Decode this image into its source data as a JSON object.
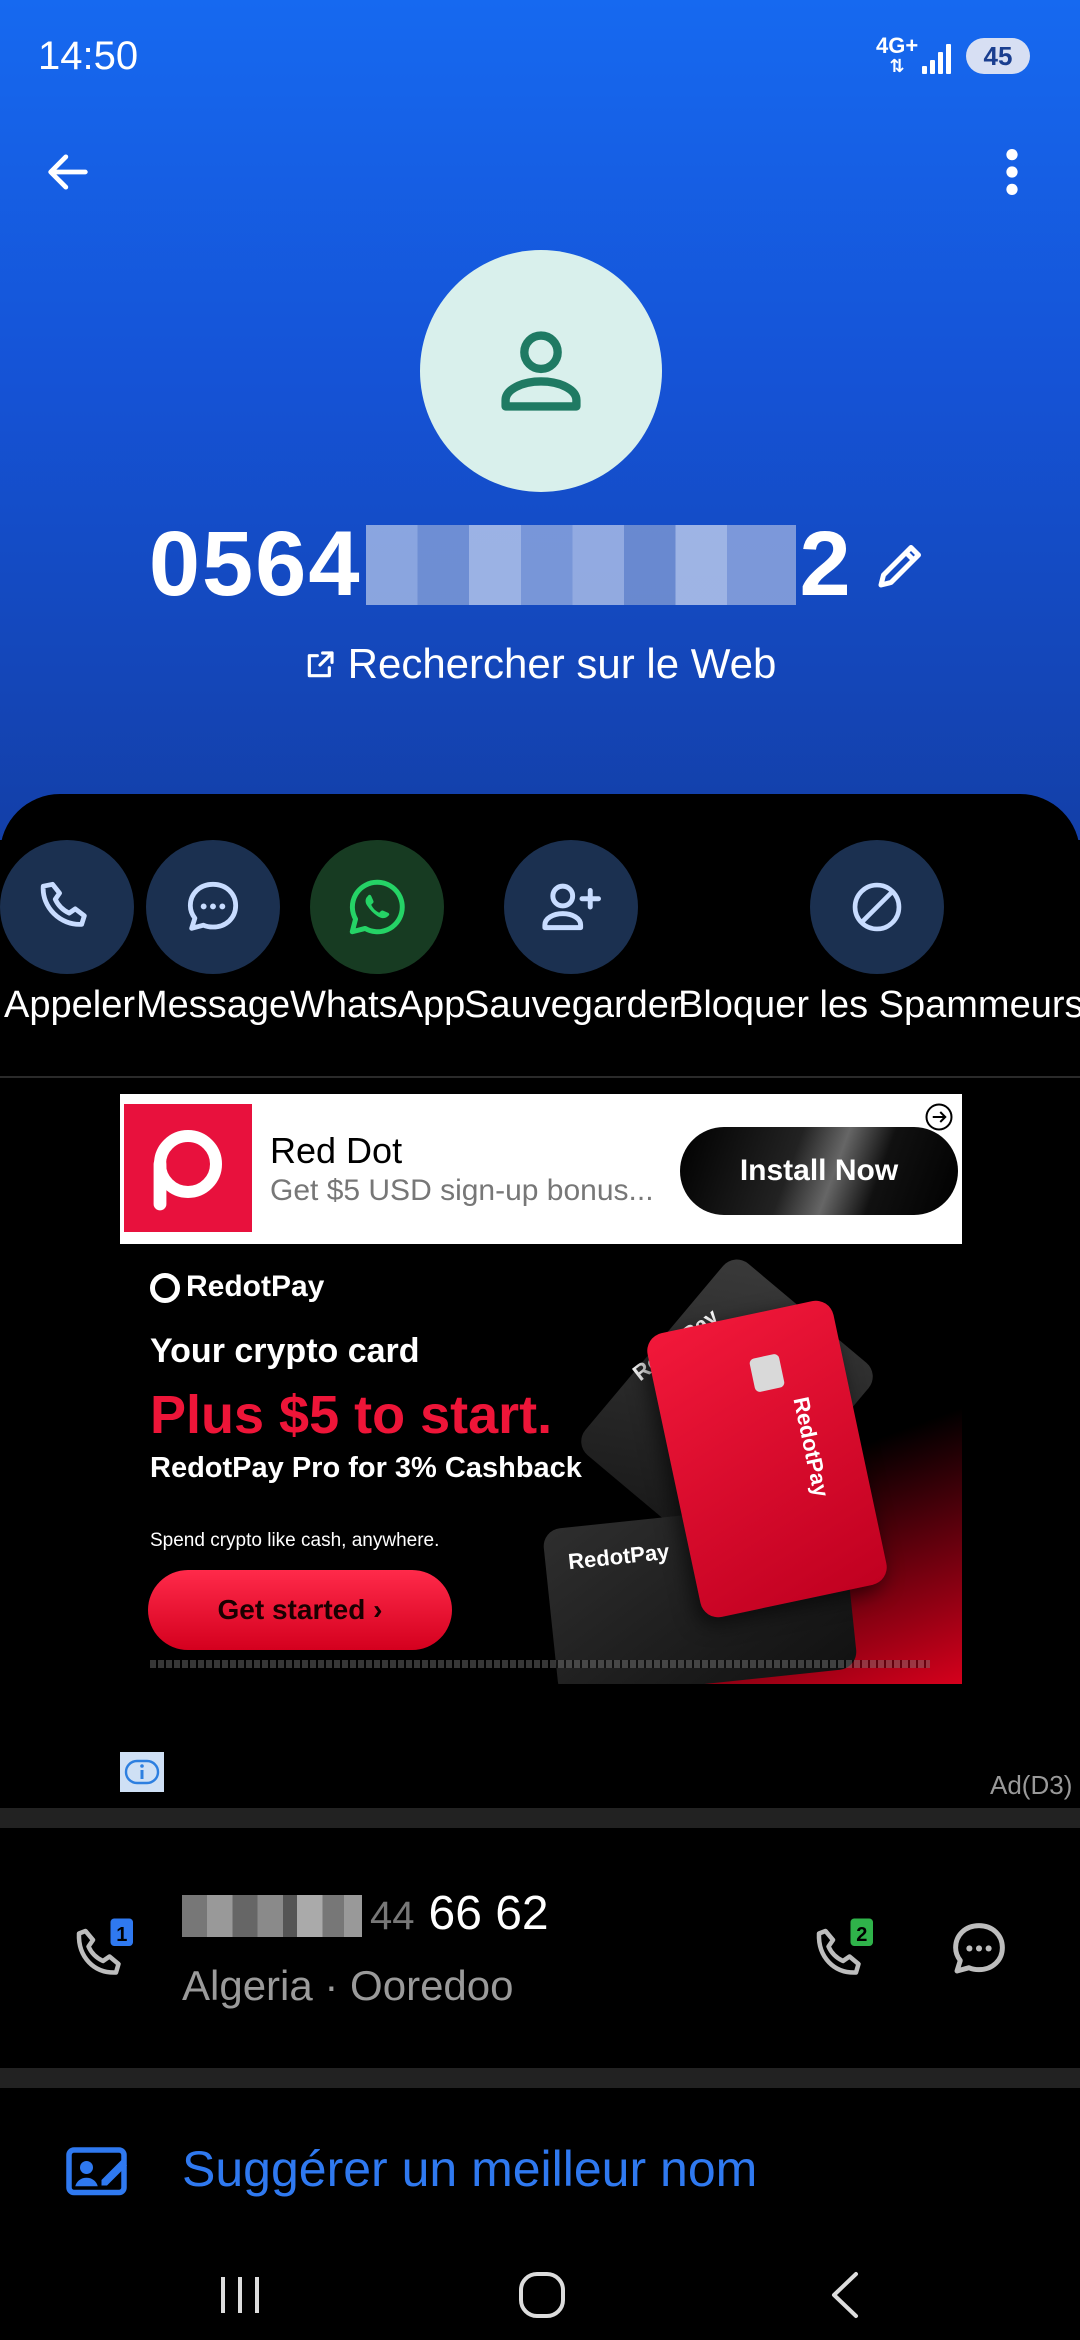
{
  "status_bar": {
    "time": "14:50",
    "network": "4G+",
    "battery": "45"
  },
  "header": {
    "phone_prefix": "0564",
    "phone_suffix": "2",
    "web_search_label": "Rechercher sur le Web"
  },
  "actions": [
    {
      "label": "Appeler",
      "icon": "phone-icon"
    },
    {
      "label": "Message",
      "icon": "chat-bubble-icon"
    },
    {
      "label": "WhatsApp",
      "icon": "whatsapp-icon"
    },
    {
      "label": "Sauvegarder",
      "icon": "add-person-icon"
    },
    {
      "label": "Bloquer les Spammeurs",
      "icon": "block-icon"
    }
  ],
  "ad": {
    "banner": {
      "title": "Red Dot",
      "subtitle": "Get $5 USD sign-up bonus...",
      "cta": "Install Now"
    },
    "creative": {
      "brand": "RedotPay",
      "line1": "Your crypto card",
      "line2": "Plus $5 to start.",
      "line3": "RedotPay Pro for 3% Cashback",
      "line4": "Spend crypto like cash, anywhere.",
      "cta": "Get started  ›"
    },
    "tag": "Ad(D3)"
  },
  "contact": {
    "number_visible": "66 62",
    "number_mid": "44",
    "carrier": "Algeria · Ooredoo",
    "sim1_badge": "1",
    "sim2_badge": "2"
  },
  "suggest": {
    "label": "Suggérer un meilleur nom"
  },
  "colors": {
    "header_blue": "#1669f0",
    "action_circle": "#1b3050",
    "whatsapp_circle": "#173b22",
    "link_blue": "#2f79f0",
    "brand_red": "#ee1538"
  }
}
